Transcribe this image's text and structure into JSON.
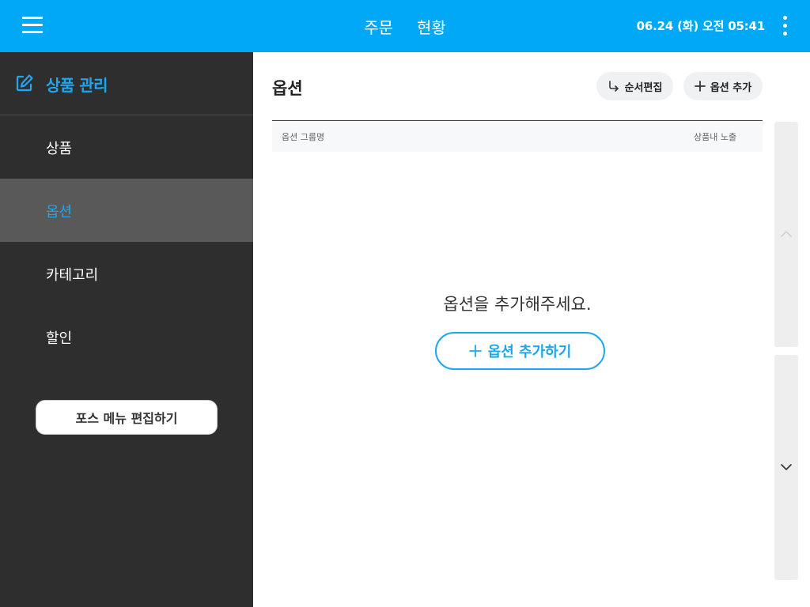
{
  "topbar": {
    "tabs": [
      "주문",
      "현황"
    ],
    "clock": "06.24 (화) 오전 05:41"
  },
  "sidebar": {
    "title": "상품 관리",
    "items": [
      {
        "label": "상품",
        "active": false
      },
      {
        "label": "옵션",
        "active": true
      },
      {
        "label": "카테고리",
        "active": false
      },
      {
        "label": "할인",
        "active": false
      }
    ],
    "pos_button": "포스 메뉴 편집하기"
  },
  "main": {
    "title": "옵션",
    "reorder_button": "순서편집",
    "add_option_button": "옵션 추가",
    "table_headers": {
      "group_name": "옵션 그룹명",
      "visibility": "상품내 노출"
    },
    "empty_message": "옵션을 추가해주세요.",
    "empty_add_button": "옵션 추가하기"
  },
  "colors": {
    "accent": "#1ea7f0",
    "topbar": "#00a8f5",
    "sidebar": "#2e2e2e",
    "sidebar_active": "#595959"
  }
}
